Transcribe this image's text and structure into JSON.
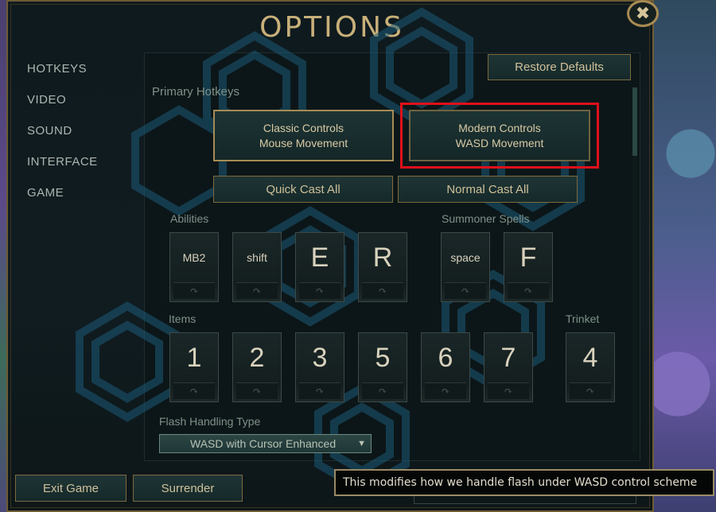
{
  "window": {
    "title": "OPTIONS",
    "close_glyph": "✖"
  },
  "nav": {
    "items": [
      {
        "label": "HOTKEYS"
      },
      {
        "label": "VIDEO"
      },
      {
        "label": "SOUND"
      },
      {
        "label": "INTERFACE"
      },
      {
        "label": "GAME"
      }
    ]
  },
  "panel": {
    "restore_defaults": "Restore Defaults",
    "section_title": "Primary Hotkeys",
    "classic_controls": {
      "line1": "Classic Controls",
      "line2": "Mouse Movement"
    },
    "modern_controls": {
      "line1": "Modern Controls",
      "line2": "WASD Movement"
    },
    "quick_cast_all": "Quick Cast All",
    "normal_cast_all": "Normal Cast All",
    "abilities_label": "Abilities",
    "summoner_label": "Summoner Spells",
    "items_label": "Items",
    "trinket_label": "Trinket",
    "ability_keys": [
      "MB2",
      "shift",
      "E",
      "R"
    ],
    "summoner_keys": [
      "space",
      "F"
    ],
    "item_keys": [
      "1",
      "2",
      "3",
      "5",
      "6",
      "7"
    ],
    "trinket_key": "4",
    "flash_label": "Flash Handling Type",
    "flash_value": "WASD with Cursor Enhanced",
    "key_subglyph": "↷"
  },
  "footer": {
    "exit_game": "Exit Game",
    "surrender": "Surrender",
    "tooltip": "This modifies how we handle flash under WASD control scheme"
  },
  "colors": {
    "accent_gold": "#c8b07a",
    "highlight_red": "#e0101a",
    "panel_bg": "#0c1618"
  }
}
